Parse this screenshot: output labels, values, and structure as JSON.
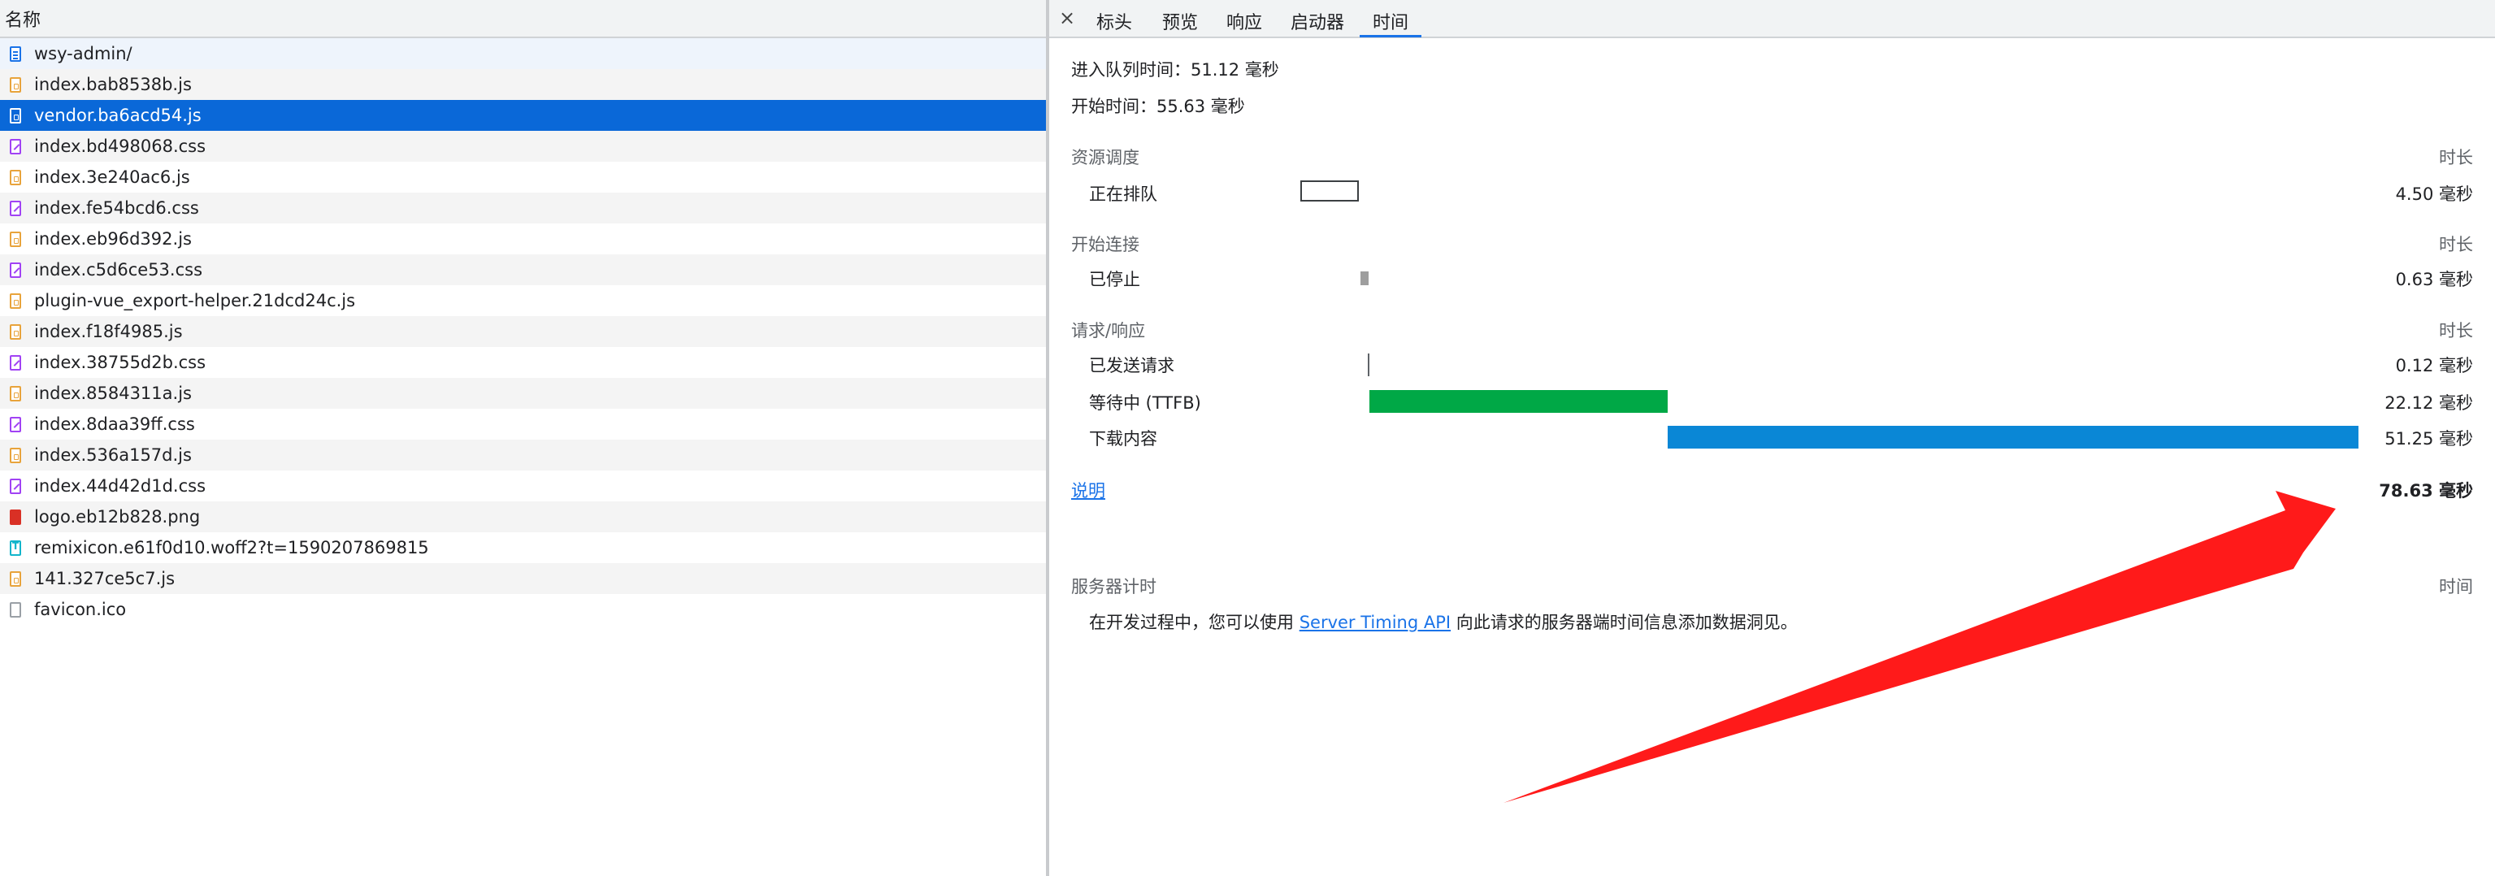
{
  "left": {
    "header": "名称",
    "files": [
      {
        "name": "wsy-admin/",
        "type": "doc"
      },
      {
        "name": "index.bab8538b.js",
        "type": "js"
      },
      {
        "name": "vendor.ba6acd54.js",
        "type": "js",
        "selected": true
      },
      {
        "name": "index.bd498068.css",
        "type": "css"
      },
      {
        "name": "index.3e240ac6.js",
        "type": "js"
      },
      {
        "name": "index.fe54bcd6.css",
        "type": "css"
      },
      {
        "name": "index.eb96d392.js",
        "type": "js"
      },
      {
        "name": "index.c5d6ce53.css",
        "type": "css"
      },
      {
        "name": "plugin-vue_export-helper.21dcd24c.js",
        "type": "js"
      },
      {
        "name": "index.f18f4985.js",
        "type": "js"
      },
      {
        "name": "index.38755d2b.css",
        "type": "css"
      },
      {
        "name": "index.8584311a.js",
        "type": "js"
      },
      {
        "name": "index.8daa39ff.css",
        "type": "css"
      },
      {
        "name": "index.536a157d.js",
        "type": "js"
      },
      {
        "name": "index.44d42d1d.css",
        "type": "css"
      },
      {
        "name": "logo.eb12b828.png",
        "type": "png"
      },
      {
        "name": "remixicon.e61f0d10.woff2?t=1590207869815",
        "type": "font"
      },
      {
        "name": "141.327ce5c7.js",
        "type": "js"
      },
      {
        "name": "favicon.ico",
        "type": "ico"
      }
    ]
  },
  "tabs": {
    "close": "×",
    "items": [
      "标头",
      "预览",
      "响应",
      "启动器",
      "时间"
    ],
    "active": 4
  },
  "timing": {
    "queued_at": "进入队列时间：51.12 毫秒",
    "started_at": "开始时间：55.63 毫秒",
    "sections": {
      "scheduling": {
        "title": "资源调度",
        "col": "时长",
        "rows": [
          {
            "label": "正在排队",
            "value": "4.50 毫秒"
          }
        ]
      },
      "connection": {
        "title": "开始连接",
        "col": "时长",
        "rows": [
          {
            "label": "已停止",
            "value": "0.63 毫秒"
          }
        ]
      },
      "request": {
        "title": "请求/响应",
        "col": "时长",
        "rows": [
          {
            "label": "已发送请求",
            "value": "0.12 毫秒"
          },
          {
            "label": "等待中 (TTFB)",
            "value": "22.12 毫秒"
          },
          {
            "label": "下载内容",
            "value": "51.25 毫秒"
          }
        ]
      }
    },
    "explain_link": "说明",
    "total": "78.63 毫秒",
    "server": {
      "title": "服务器计时",
      "col": "时间",
      "text_before": "在开发过程中，您可以使用 ",
      "link": "Server Timing API",
      "text_after": " 向此请求的服务器端时间信息添加数据洞见。"
    },
    "colors": {
      "queue": "#ffffff",
      "stalled": "#9e9e9e",
      "sent": "#5f6368",
      "ttfb": "#00a846",
      "download": "#0a87d6",
      "arrow": "#ff1a1a"
    }
  }
}
